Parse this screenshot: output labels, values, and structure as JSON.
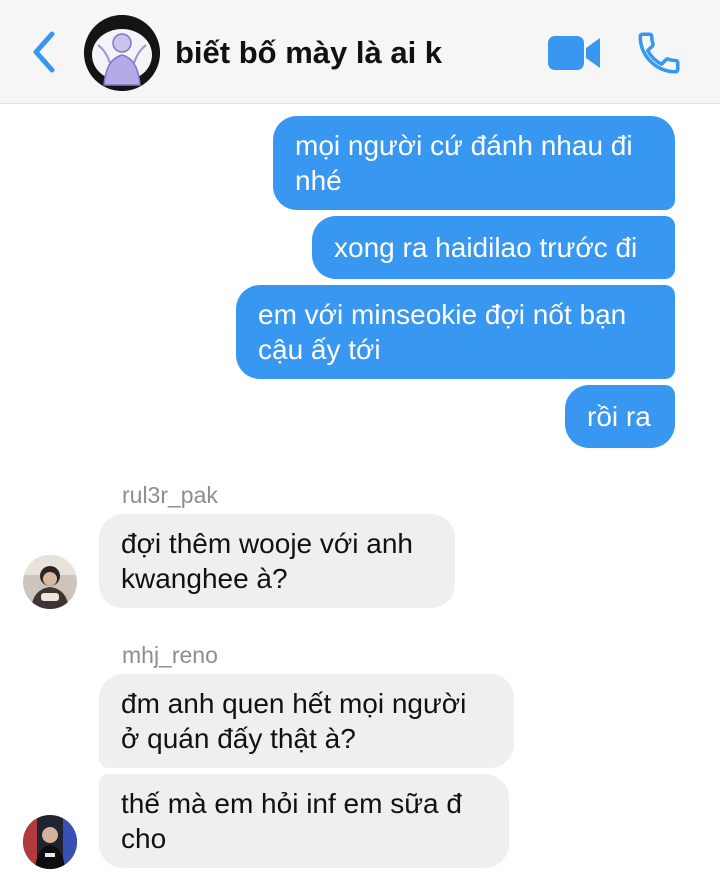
{
  "header": {
    "title": "biết bố mày là ai k",
    "back_icon": "chevron-left-icon",
    "video_icon": "video-camera-icon",
    "call_icon": "phone-icon",
    "accent": "#3897f0"
  },
  "messages": {
    "outgoing": [
      "mọi người cứ đánh nhau đi nhé",
      "xong ra haidilao trước đi",
      "em với minseokie đợi nốt bạn cậu ấy tới",
      "rồi ra"
    ],
    "groups": [
      {
        "sender": "rul3r_pak",
        "texts": [
          "đợi thêm wooje với anh kwanghee à?"
        ]
      },
      {
        "sender": "mhj_reno",
        "texts": [
          "đm anh quen hết mọi người ở quán đấy thật à?",
          "thế mà em hỏi inf em sữa đ cho"
        ]
      }
    ]
  },
  "colors": {
    "outgoing_bubble": "#3897f0",
    "incoming_bubble": "#efefef",
    "header_bg": "#f6f6f7"
  }
}
